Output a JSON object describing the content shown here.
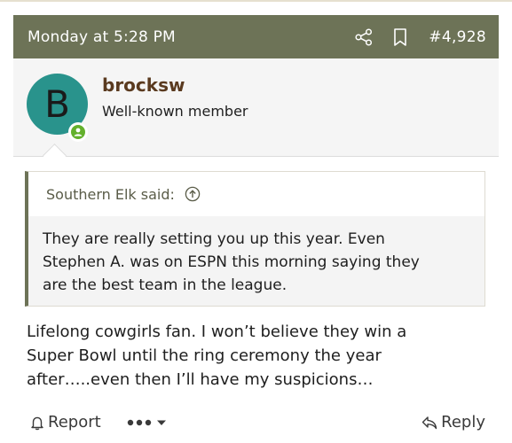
{
  "post": {
    "date": "Monday at 5:28 PM",
    "number": "#4,928"
  },
  "user": {
    "avatar_letter": "B",
    "avatar_color": "#29938c",
    "username": "brocksw",
    "title": "Well-known member",
    "online": true
  },
  "quote": {
    "title": "Southern Elk said:",
    "lines": [
      "They are really setting you up this year. Even",
      "Stephen A. was on ESPN this morning saying they",
      "are the best team in the league."
    ]
  },
  "message": {
    "lines": [
      "Lifelong cowgirls fan. I won’t believe they win a",
      "Super Bowl until the ring ceremony the year",
      "after…..even then I’ll have my suspicions…"
    ]
  },
  "actions": {
    "report_label": "Report",
    "reply_label": "Reply"
  },
  "icons": {
    "share": "share-icon",
    "bookmark": "bookmark-icon",
    "quote_jump": "arrow-up-circle-icon",
    "report": "bell-icon",
    "more": "ellipsis-icon",
    "dropdown": "caret-down-icon",
    "reply": "reply-arrow-icon"
  },
  "colors": {
    "header_bg": "#6d7357",
    "username": "#5a3a1f",
    "online": "#63b02c"
  }
}
